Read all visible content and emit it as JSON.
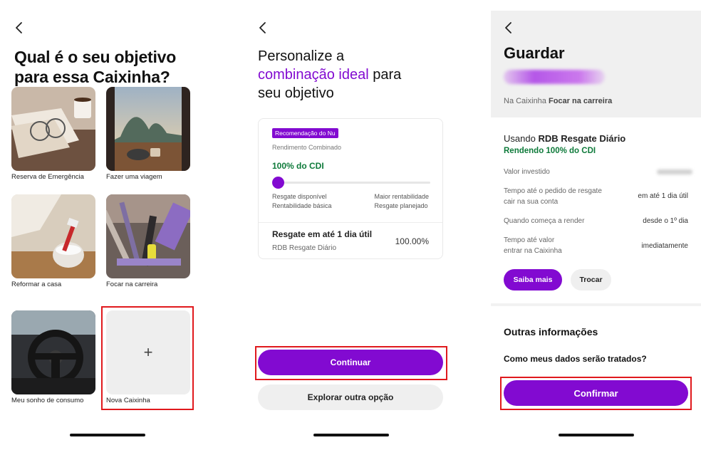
{
  "screen1": {
    "title": "Qual é o seu objetivo para essa Caixinha?",
    "cards": [
      {
        "label": "Reserva de Emergência",
        "image": "coffee-glasses-photo"
      },
      {
        "label": "Fazer uma viagem",
        "image": "travel-view-photo"
      },
      {
        "label": "Reformar a casa",
        "image": "paint-bucket-photo"
      },
      {
        "label": "Focar na carreira",
        "image": "office-supplies-photo"
      },
      {
        "label": "Meu sonho de consumo",
        "image": "car-interior-photo"
      },
      {
        "label": "Nova Caixinha",
        "icon": "plus-icon",
        "plus": "+"
      }
    ]
  },
  "screen2": {
    "title_prefix": "Personalize a",
    "title_highlight": "combinação ideal",
    "title_suffix_1": "para",
    "title_suffix_2": "seu objetivo",
    "badge": "Recomendação do Nu",
    "subtitle": "Rendimento Combinado",
    "cdi": "100% do CDI",
    "slider": {
      "level": 0
    },
    "left_label_1": "Resgate disponível",
    "left_label_2": "Rentabilidade básica",
    "right_label_1": "Maior rentabilidade",
    "right_label_2": "Resgate planejado",
    "result_title": "Resgate em até 1 dia útil",
    "result_sub": "RDB Resgate Diário",
    "result_pct": "100.00%",
    "continue_button": "Continuar",
    "explore_button": "Explorar outra opção"
  },
  "screen3": {
    "title": "Guardar",
    "caixinha_prefix": "Na Caixinha",
    "caixinha_name": "Focar na carreira",
    "usando_prefix": "Usando",
    "usando_product": "RDB Resgate Diário",
    "rendendo": "Rendendo 100% do CDI",
    "rows": [
      {
        "label": "Valor investido",
        "value": ""
      },
      {
        "label": "Tempo até o pedido de resgate cair na sua conta",
        "value": "em até 1 dia útil"
      },
      {
        "label": "Quando começa a render",
        "value": "desde o 1º dia"
      },
      {
        "label": "Tempo até valor entrar na Caixinha",
        "value": "imediatamente"
      }
    ],
    "saiba_mais": "Saiba mais",
    "trocar": "Trocar",
    "outras": "Outras informações",
    "como": "Como meus dados serão tratados?",
    "confirm_button": "Confirmar"
  },
  "colors": {
    "brand_purple": "#820ad1",
    "green": "#0e7a3a",
    "highlight_red": "#e0191d"
  }
}
